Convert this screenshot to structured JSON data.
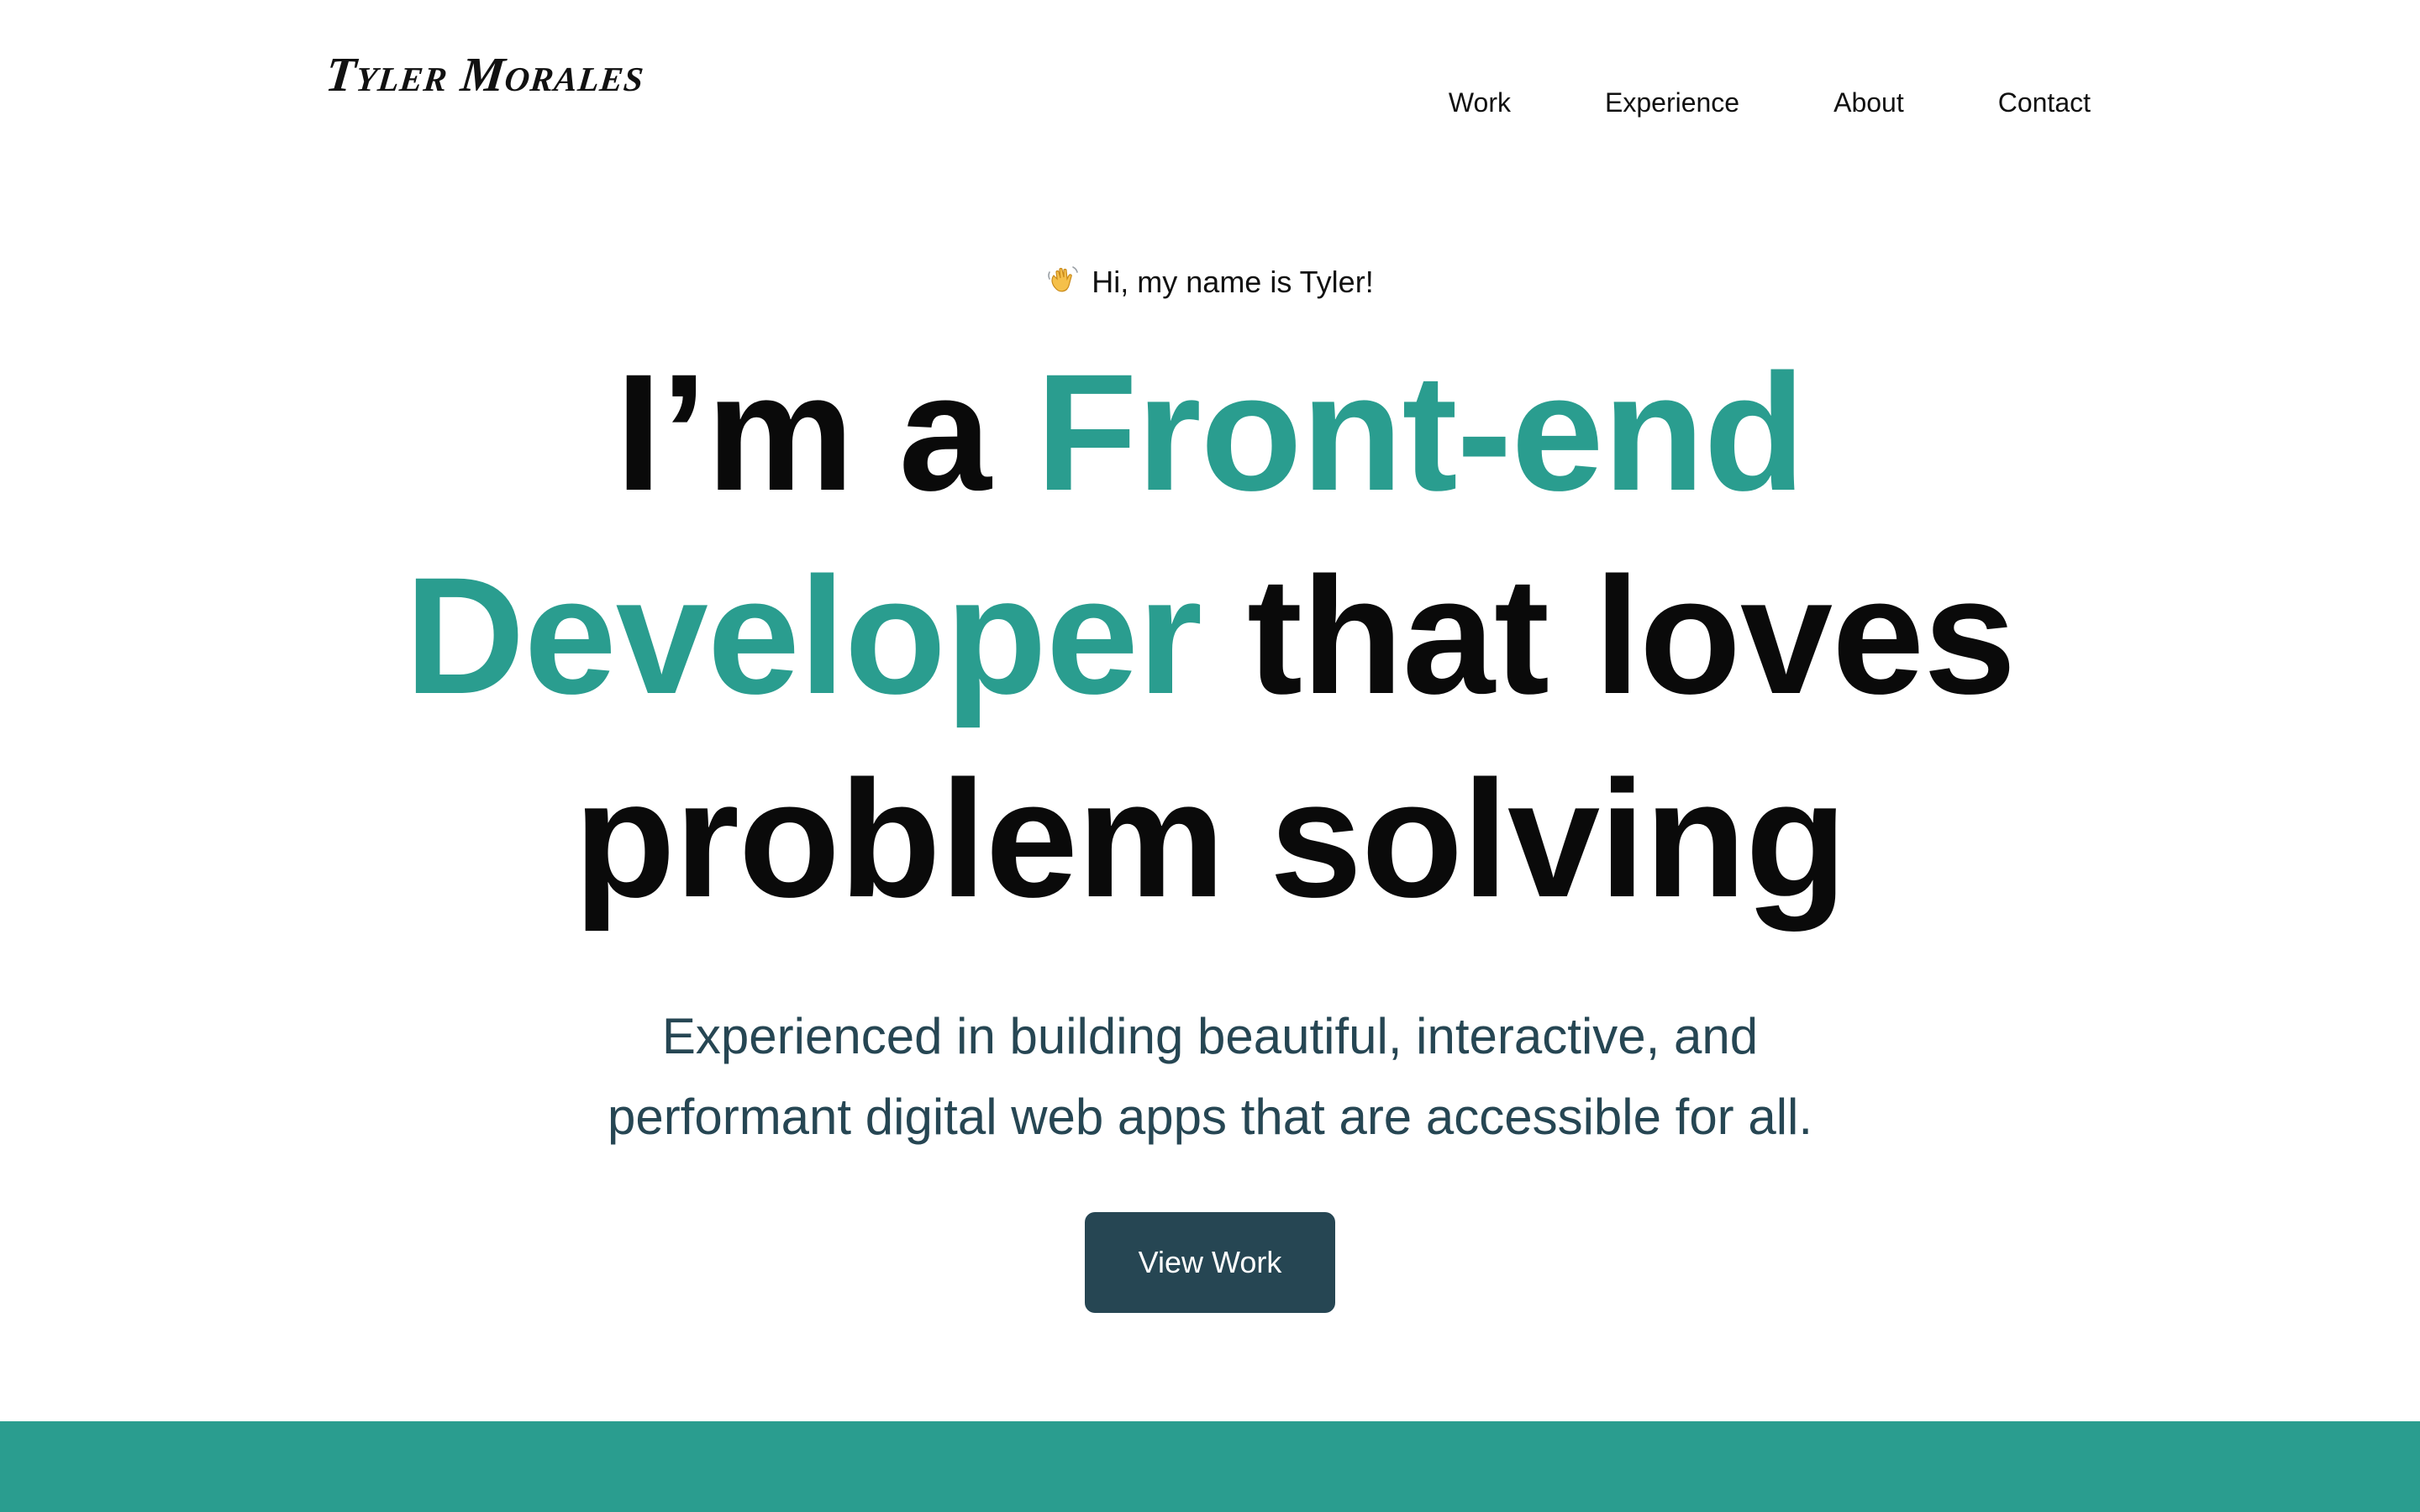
{
  "header": {
    "logo_text": "Tyler Morales",
    "nav": [
      {
        "label": "Work"
      },
      {
        "label": "Experience"
      },
      {
        "label": "About"
      },
      {
        "label": "Contact"
      }
    ]
  },
  "hero": {
    "greeting_icon": "waving-hand-icon",
    "greeting": "Hi, my name is Tyler!",
    "headline": {
      "l1_plain": "I’m a ",
      "l1_accent": "Front-end",
      "l2_accent": "Developer",
      "l2_plain": " that loves",
      "l3_plain": "problem solving"
    },
    "subtitle": {
      "line1": "Experienced in building beautiful, interactive, and",
      "line2": "performant digital web apps that are accessible for all."
    },
    "cta_label": "View Work"
  },
  "colors": {
    "accent": "#2a9d8f",
    "button": "#264653",
    "subtitle_text": "#264653",
    "text": "#0a0a0a"
  }
}
